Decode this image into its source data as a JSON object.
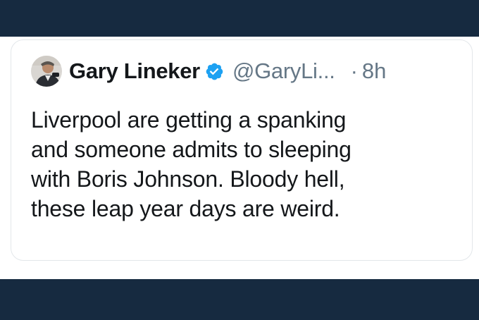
{
  "tweet": {
    "author_name": "Gary Lineker",
    "handle": "@GaryLi...",
    "separator": "·",
    "timestamp": "8h",
    "text": "Liverpool are getting a spanking\nand someone admits to sleeping\nwith Boris Johnson. Bloody hell,\nthese leap year days are weird.",
    "verified_icon": "verified-badge-icon",
    "avatar": "profile-photo"
  },
  "colors": {
    "band": "#162a40",
    "verified": "#1da1f2",
    "secondary_text": "#657786",
    "primary_text": "#14171a"
  }
}
